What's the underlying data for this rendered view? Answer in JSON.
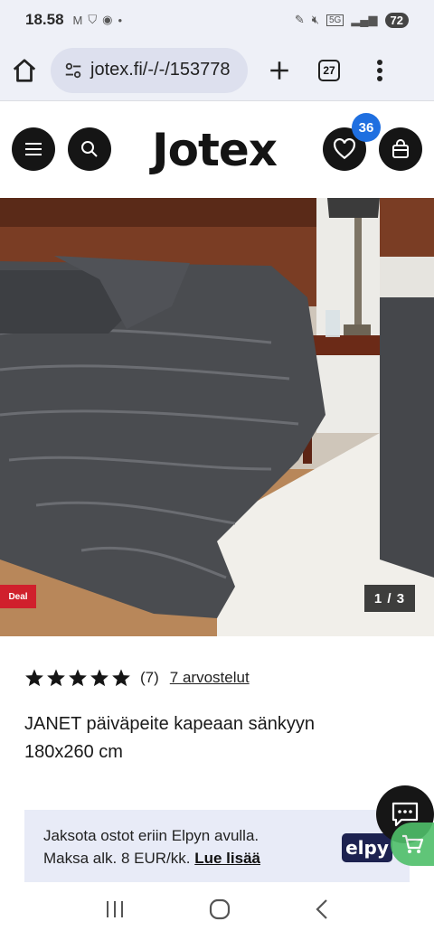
{
  "status_bar": {
    "time": "18.58",
    "battery": "72",
    "network": "5G"
  },
  "browser": {
    "url": "jotex.fi/-/-/153778",
    "tab_count": "27"
  },
  "site": {
    "logo": "Jotex",
    "wishlist_count": "36"
  },
  "hero": {
    "deal_label": "Deal",
    "slide_counter": "1 / 3"
  },
  "product": {
    "rating": 5,
    "review_count": "(7)",
    "review_link": "7 arvostelut",
    "title": "JANET päiväpeite kapeaan sänkyyn 180x260 cm"
  },
  "finance": {
    "line1": "Jaksota ostot eriin Elpyn avulla.",
    "line2": "Maksa alk. 8 EUR/kk.",
    "link": "Lue lisää",
    "brand": "elpy"
  },
  "icons": [
    "home-icon",
    "tune-icon",
    "plus-icon",
    "tabs-icon",
    "more-icon",
    "menu-icon",
    "search-icon",
    "heart-icon",
    "bag-icon",
    "star-icon",
    "chat-icon",
    "cart-icon",
    "recents-icon",
    "home-circle-icon",
    "back-icon"
  ]
}
